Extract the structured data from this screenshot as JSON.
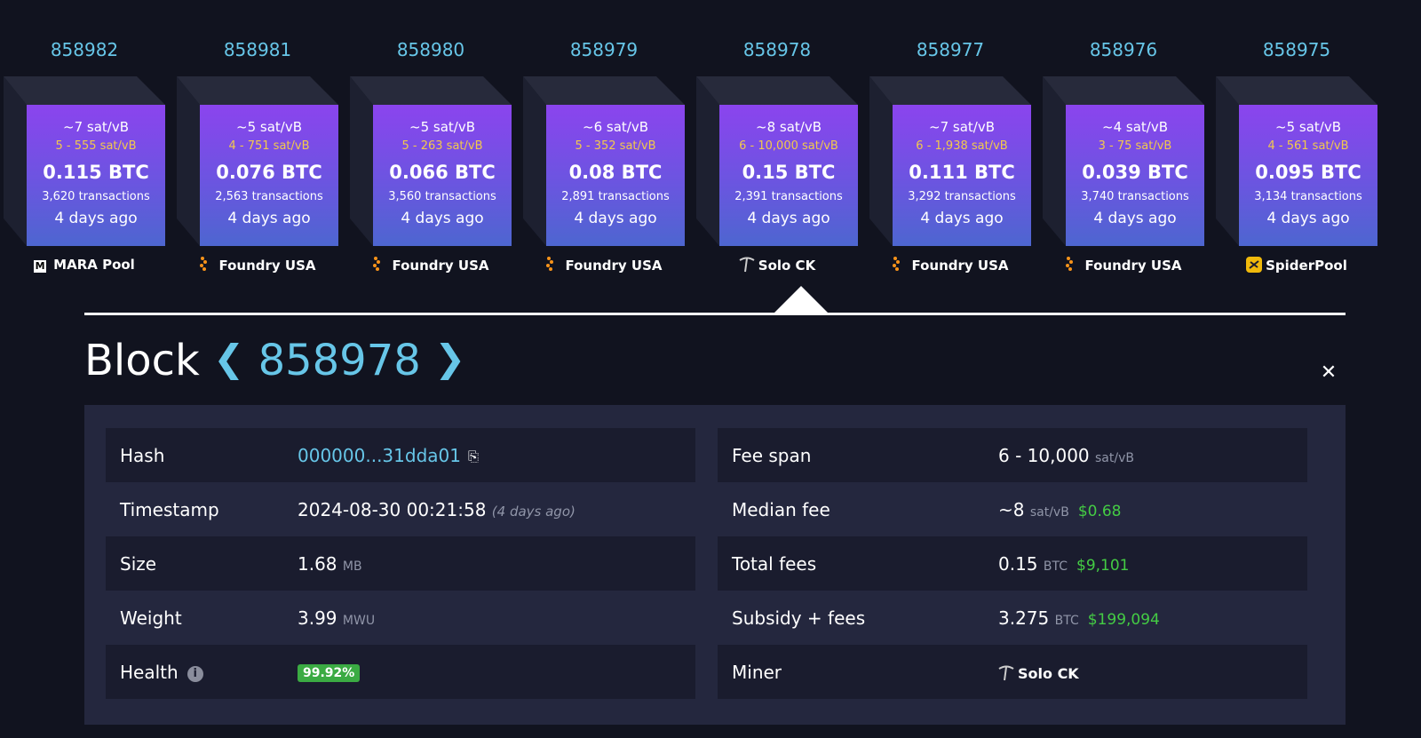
{
  "blocks": [
    {
      "height": "858982",
      "median": "~7 sat/vB",
      "range": "5 - 555 sat/vB",
      "reward": "0.115 BTC",
      "tx": "3,620 transactions",
      "time": "4 days ago",
      "pool": "MARA Pool",
      "pool_icon": "mara-icon"
    },
    {
      "height": "858981",
      "median": "~5 sat/vB",
      "range": "4 - 751 sat/vB",
      "reward": "0.076 BTC",
      "tx": "2,563 transactions",
      "time": "4 days ago",
      "pool": "Foundry USA",
      "pool_icon": "foundry-icon"
    },
    {
      "height": "858980",
      "median": "~5 sat/vB",
      "range": "5 - 263 sat/vB",
      "reward": "0.066 BTC",
      "tx": "3,560 transactions",
      "time": "4 days ago",
      "pool": "Foundry USA",
      "pool_icon": "foundry-icon"
    },
    {
      "height": "858979",
      "median": "~6 sat/vB",
      "range": "5 - 352 sat/vB",
      "reward": "0.08 BTC",
      "tx": "2,891 transactions",
      "time": "4 days ago",
      "pool": "Foundry USA",
      "pool_icon": "foundry-icon"
    },
    {
      "height": "858978",
      "median": "~8 sat/vB",
      "range": "6 - 10,000 sat/vB",
      "reward": "0.15 BTC",
      "tx": "2,391 transactions",
      "time": "4 days ago",
      "pool": "Solo CK",
      "pool_icon": "pickaxe-icon"
    },
    {
      "height": "858977",
      "median": "~7 sat/vB",
      "range": "6 - 1,938 sat/vB",
      "reward": "0.111 BTC",
      "tx": "3,292 transactions",
      "time": "4 days ago",
      "pool": "Foundry USA",
      "pool_icon": "foundry-icon"
    },
    {
      "height": "858976",
      "median": "~4 sat/vB",
      "range": "3 - 75 sat/vB",
      "reward": "0.039 BTC",
      "tx": "3,740 transactions",
      "time": "4 days ago",
      "pool": "Foundry USA",
      "pool_icon": "foundry-icon"
    },
    {
      "height": "858975",
      "median": "~5 sat/vB",
      "range": "4 - 561 sat/vB",
      "reward": "0.095 BTC",
      "tx": "3,134 transactions",
      "time": "4 days ago",
      "pool": "SpiderPool",
      "pool_icon": "spiderpool-icon"
    }
  ],
  "detail": {
    "title": "Block",
    "height": "858978",
    "prev_icon": "chevron-left-icon",
    "next_icon": "chevron-right-icon",
    "close_icon": "close-icon",
    "left": {
      "hash_label": "Hash",
      "hash_value": "000000...31dda01",
      "timestamp_label": "Timestamp",
      "timestamp_value": "2024-08-30 00:21:58",
      "timestamp_relative": "(4 days ago)",
      "size_label": "Size",
      "size_value": "1.68",
      "size_unit": "MB",
      "weight_label": "Weight",
      "weight_value": "3.99",
      "weight_unit": "MWU",
      "health_label": "Health",
      "health_value": "99.92%"
    },
    "right": {
      "feespan_label": "Fee span",
      "feespan_value": "6 - 10,000",
      "feespan_unit": "sat/vB",
      "median_label": "Median fee",
      "median_value": "~8",
      "median_unit": "sat/vB",
      "median_fiat": "$0.68",
      "total_label": "Total fees",
      "total_value": "0.15",
      "total_unit": "BTC",
      "total_fiat": "$9,101",
      "subsidy_label": "Subsidy + fees",
      "subsidy_value": "3.275",
      "subsidy_unit": "BTC",
      "subsidy_fiat": "$199,094",
      "miner_label": "Miner",
      "miner_value": "Solo CK"
    }
  },
  "colors": {
    "accent": "#67c6e8",
    "fiat": "#44cc44",
    "health": "#3bab43",
    "fee_range": "#f2c94c"
  }
}
